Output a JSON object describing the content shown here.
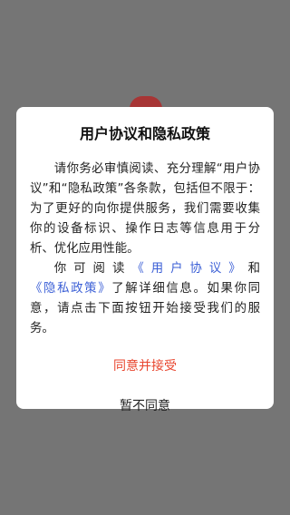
{
  "dialog": {
    "title": "用户协议和隐私政策",
    "paragraph1": "请你务必审慎阅读、充分理解“用户协议”和“隐私政策”各条款，包括但不限于：为了更好的向你提供服务，我们需要收集你的设备标识、操作日志等信息用于分析、优化应用性能。",
    "paragraph2": {
      "prefix": "你可阅读",
      "user_agreement_link": "《用户协议》",
      "conjunction": "和",
      "privacy_policy_link": "《隐私政策》",
      "suffix": "了解详细信息。如果你同意，请点击下面按钮开始接受我们的服务。"
    },
    "agree_label": "同意并接受",
    "disagree_label": "暂不同意"
  },
  "colors": {
    "backdrop": "#757575",
    "link": "#3b5fd6",
    "agree": "#e8462f"
  }
}
